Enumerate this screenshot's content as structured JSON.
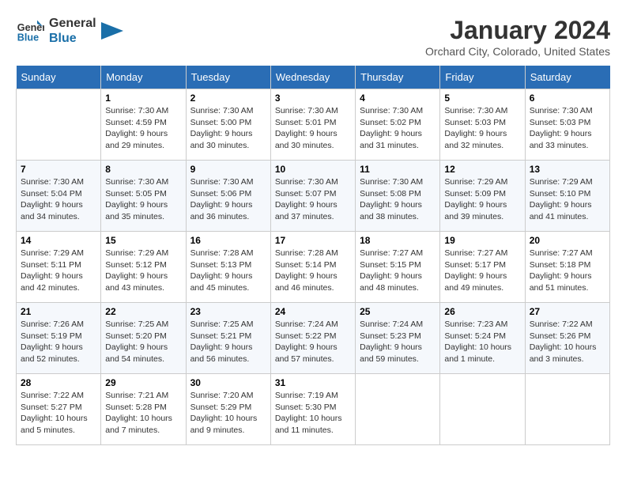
{
  "header": {
    "logo_line1": "General",
    "logo_line2": "Blue",
    "month_title": "January 2024",
    "location": "Orchard City, Colorado, United States"
  },
  "days_of_week": [
    "Sunday",
    "Monday",
    "Tuesday",
    "Wednesday",
    "Thursday",
    "Friday",
    "Saturday"
  ],
  "weeks": [
    [
      {
        "day": "",
        "empty": true
      },
      {
        "day": "1",
        "sunrise": "7:30 AM",
        "sunset": "4:59 PM",
        "daylight": "9 hours and 29 minutes."
      },
      {
        "day": "2",
        "sunrise": "7:30 AM",
        "sunset": "5:00 PM",
        "daylight": "9 hours and 30 minutes."
      },
      {
        "day": "3",
        "sunrise": "7:30 AM",
        "sunset": "5:01 PM",
        "daylight": "9 hours and 30 minutes."
      },
      {
        "day": "4",
        "sunrise": "7:30 AM",
        "sunset": "5:02 PM",
        "daylight": "9 hours and 31 minutes."
      },
      {
        "day": "5",
        "sunrise": "7:30 AM",
        "sunset": "5:03 PM",
        "daylight": "9 hours and 32 minutes."
      },
      {
        "day": "6",
        "sunrise": "7:30 AM",
        "sunset": "5:03 PM",
        "daylight": "9 hours and 33 minutes."
      }
    ],
    [
      {
        "day": "7",
        "sunrise": "7:30 AM",
        "sunset": "5:04 PM",
        "daylight": "9 hours and 34 minutes."
      },
      {
        "day": "8",
        "sunrise": "7:30 AM",
        "sunset": "5:05 PM",
        "daylight": "9 hours and 35 minutes."
      },
      {
        "day": "9",
        "sunrise": "7:30 AM",
        "sunset": "5:06 PM",
        "daylight": "9 hours and 36 minutes."
      },
      {
        "day": "10",
        "sunrise": "7:30 AM",
        "sunset": "5:07 PM",
        "daylight": "9 hours and 37 minutes."
      },
      {
        "day": "11",
        "sunrise": "7:30 AM",
        "sunset": "5:08 PM",
        "daylight": "9 hours and 38 minutes."
      },
      {
        "day": "12",
        "sunrise": "7:29 AM",
        "sunset": "5:09 PM",
        "daylight": "9 hours and 39 minutes."
      },
      {
        "day": "13",
        "sunrise": "7:29 AM",
        "sunset": "5:10 PM",
        "daylight": "9 hours and 41 minutes."
      }
    ],
    [
      {
        "day": "14",
        "sunrise": "7:29 AM",
        "sunset": "5:11 PM",
        "daylight": "9 hours and 42 minutes."
      },
      {
        "day": "15",
        "sunrise": "7:29 AM",
        "sunset": "5:12 PM",
        "daylight": "9 hours and 43 minutes."
      },
      {
        "day": "16",
        "sunrise": "7:28 AM",
        "sunset": "5:13 PM",
        "daylight": "9 hours and 45 minutes."
      },
      {
        "day": "17",
        "sunrise": "7:28 AM",
        "sunset": "5:14 PM",
        "daylight": "9 hours and 46 minutes."
      },
      {
        "day": "18",
        "sunrise": "7:27 AM",
        "sunset": "5:15 PM",
        "daylight": "9 hours and 48 minutes."
      },
      {
        "day": "19",
        "sunrise": "7:27 AM",
        "sunset": "5:17 PM",
        "daylight": "9 hours and 49 minutes."
      },
      {
        "day": "20",
        "sunrise": "7:27 AM",
        "sunset": "5:18 PM",
        "daylight": "9 hours and 51 minutes."
      }
    ],
    [
      {
        "day": "21",
        "sunrise": "7:26 AM",
        "sunset": "5:19 PM",
        "daylight": "9 hours and 52 minutes."
      },
      {
        "day": "22",
        "sunrise": "7:25 AM",
        "sunset": "5:20 PM",
        "daylight": "9 hours and 54 minutes."
      },
      {
        "day": "23",
        "sunrise": "7:25 AM",
        "sunset": "5:21 PM",
        "daylight": "9 hours and 56 minutes."
      },
      {
        "day": "24",
        "sunrise": "7:24 AM",
        "sunset": "5:22 PM",
        "daylight": "9 hours and 57 minutes."
      },
      {
        "day": "25",
        "sunrise": "7:24 AM",
        "sunset": "5:23 PM",
        "daylight": "9 hours and 59 minutes."
      },
      {
        "day": "26",
        "sunrise": "7:23 AM",
        "sunset": "5:24 PM",
        "daylight": "10 hours and 1 minute."
      },
      {
        "day": "27",
        "sunrise": "7:22 AM",
        "sunset": "5:26 PM",
        "daylight": "10 hours and 3 minutes."
      }
    ],
    [
      {
        "day": "28",
        "sunrise": "7:22 AM",
        "sunset": "5:27 PM",
        "daylight": "10 hours and 5 minutes."
      },
      {
        "day": "29",
        "sunrise": "7:21 AM",
        "sunset": "5:28 PM",
        "daylight": "10 hours and 7 minutes."
      },
      {
        "day": "30",
        "sunrise": "7:20 AM",
        "sunset": "5:29 PM",
        "daylight": "10 hours and 9 minutes."
      },
      {
        "day": "31",
        "sunrise": "7:19 AM",
        "sunset": "5:30 PM",
        "daylight": "10 hours and 11 minutes."
      },
      {
        "day": "",
        "empty": true
      },
      {
        "day": "",
        "empty": true
      },
      {
        "day": "",
        "empty": true
      }
    ]
  ],
  "labels": {
    "sunrise_prefix": "Sunrise: ",
    "sunset_prefix": "Sunset: ",
    "daylight_prefix": "Daylight: "
  }
}
